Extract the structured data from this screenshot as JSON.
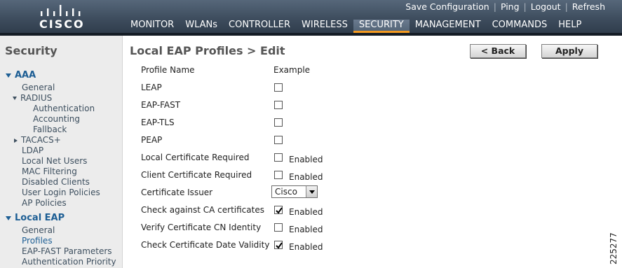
{
  "brand": {
    "logo_text": "CISCO"
  },
  "top_links": [
    "Save Configuration",
    "Ping",
    "Logout",
    "Refresh"
  ],
  "nav": [
    "MONITOR",
    "WLANs",
    "CONTROLLER",
    "WIRELESS",
    "SECURITY",
    "MANAGEMENT",
    "COMMANDS",
    "HELP"
  ],
  "nav_active": "SECURITY",
  "accent_color": "#f39a21",
  "sidebar": {
    "title": "Security",
    "aaa": {
      "label": "AAA",
      "items": [
        "General",
        "RADIUS"
      ],
      "radius_items": [
        "Authentication",
        "Accounting",
        "Fallback"
      ],
      "more_items": [
        "TACACS+",
        "LDAP",
        "Local Net Users",
        "MAC Filtering",
        "Disabled Clients",
        "User Login Policies",
        "AP Policies"
      ]
    },
    "local_eap": {
      "label": "Local EAP",
      "items": [
        "General",
        "Profiles",
        "EAP-FAST Parameters",
        "Authentication Priority"
      ],
      "current": "Profiles"
    }
  },
  "page": {
    "title": "Local EAP Profiles > Edit",
    "back_label": "< Back",
    "apply_label": "Apply"
  },
  "form": {
    "profile_name_label": "Profile Name",
    "profile_name_value": "Example",
    "enabled_label": "Enabled",
    "rows": [
      {
        "label": "LEAP",
        "checked": false
      },
      {
        "label": "EAP-FAST",
        "checked": false
      },
      {
        "label": "EAP-TLS",
        "checked": false
      },
      {
        "label": "PEAP",
        "checked": false
      },
      {
        "label": "Local Certificate Required",
        "checked": false
      },
      {
        "label": "Client Certificate Required",
        "checked": false
      },
      {
        "label": "Certificate Issuer",
        "value": "Cisco"
      },
      {
        "label": "Check against CA certificates",
        "checked": true
      },
      {
        "label": "Verify Certificate CN Identity",
        "checked": false
      },
      {
        "label": "Check Certificate Date Validity",
        "checked": true
      }
    ]
  },
  "doc_id": "225277"
}
